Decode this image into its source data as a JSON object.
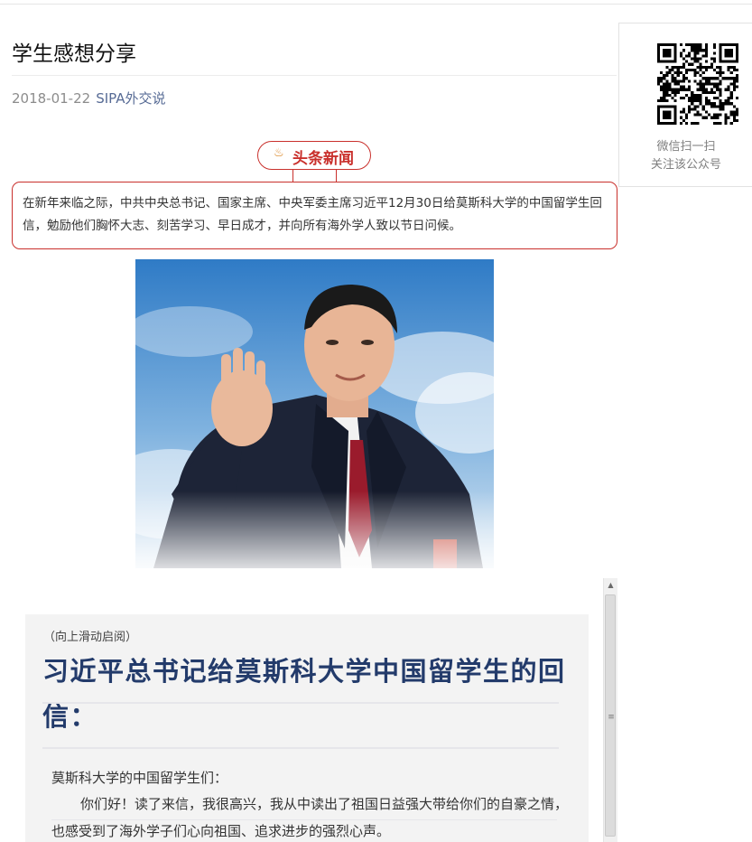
{
  "article": {
    "title": "学生感想分享",
    "date": "2018-01-22",
    "account": "SIPA外交说"
  },
  "qr": {
    "line1": "微信扫一扫",
    "line2": "关注该公众号"
  },
  "hot": {
    "icon": "flame-icon",
    "label": "头条新闻"
  },
  "intro": "在新年来临之际，中共中央总书记、国家主席、中央军委主席习近平12月30日给莫斯科大学的中国留学生回信，勉励他们胸怀大志、刻苦学习、早日成才，并向所有海外学人致以节日问候。",
  "letter": {
    "hint": "（向上滑动启阅）",
    "title": "习近平总书记给莫斯科大学中国留学生的回信：",
    "salutation": "莫斯科大学的中国留学生们：",
    "body": "你们好！读了来信，我很高兴，我从中读出了祖国日益强大带给你们的自豪之情，也感受到了海外学子们心向祖国、追求进步的强烈心声。"
  },
  "colors": {
    "accent_red": "#c9302c",
    "letter_title": "#233b6b",
    "link_blue": "#576b95"
  }
}
